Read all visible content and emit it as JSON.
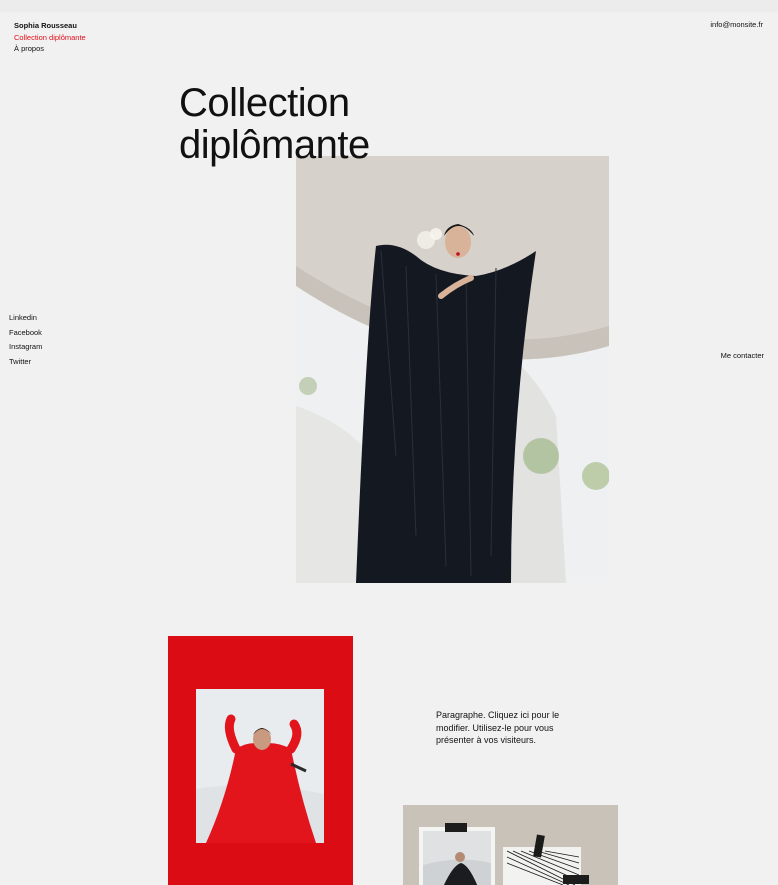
{
  "header": {
    "brand": "Sophia Rousseau",
    "nav": [
      "Collection diplômante",
      "À propos"
    ],
    "email": "info@monsite.fr"
  },
  "main": {
    "title_line1": "Collection",
    "title_line2": "diplômante",
    "paragraph": "Paragraphe. Cliquez ici pour le modifier. Utilisez-le pour vous présenter à vos visiteurs."
  },
  "social": [
    "Linkedin",
    "Facebook",
    "Instagram",
    "Twitter"
  ],
  "contact": "Me contacter",
  "colors": {
    "accent": "#e0101a",
    "background": "#f1f1f1"
  }
}
